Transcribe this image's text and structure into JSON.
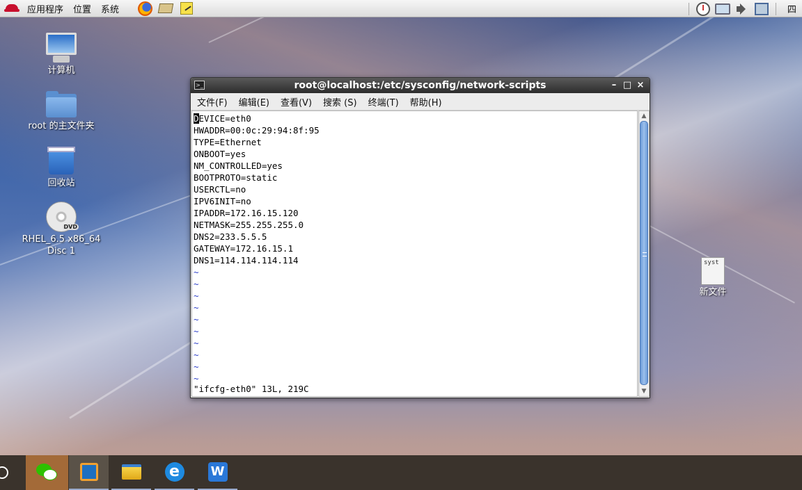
{
  "top_panel": {
    "menus": [
      "应用程序",
      "位置",
      "系统"
    ],
    "weekday": "四"
  },
  "desktop_icons": [
    {
      "label": "计算机",
      "icon": "computer-icon"
    },
    {
      "label": "root 的主文件夹",
      "icon": "home-folder-icon"
    },
    {
      "label": "回收站",
      "icon": "trash-icon"
    },
    {
      "label": "RHEL_6.5 x86_64\nDisc 1",
      "icon": "dvd-icon",
      "badge": "DVD"
    },
    {
      "label": "新文件",
      "icon": "file-icon",
      "thumb_text": "syst"
    }
  ],
  "terminal": {
    "title": "root@localhost:/etc/sysconfig/network-scripts",
    "menus": [
      "文件(F)",
      "编辑(E)",
      "查看(V)",
      "搜索 (S)",
      "终端(T)",
      "帮助(H)"
    ],
    "first_char": "D",
    "lines": [
      "EVICE=eth0",
      "HWADDR=00:0c:29:94:8f:95",
      "TYPE=Ethernet",
      "ONBOOT=yes",
      "NM_CONTROLLED=yes",
      "BOOTPROTO=static",
      "USERCTL=no",
      "IPV6INIT=no",
      "IPADDR=172.16.15.120",
      "NETMASK=255.255.255.0",
      "DNS2=233.5.5.5",
      "GATEWAY=172.16.15.1",
      "DNS1=114.114.114.114"
    ],
    "tilde": "~",
    "status": "\"ifcfg-eth0\" 13L, 219C"
  },
  "colors": {
    "tilde": "#2a3cc8",
    "titlebar": "#2c2c2c",
    "taskbar": "#3a332c"
  }
}
